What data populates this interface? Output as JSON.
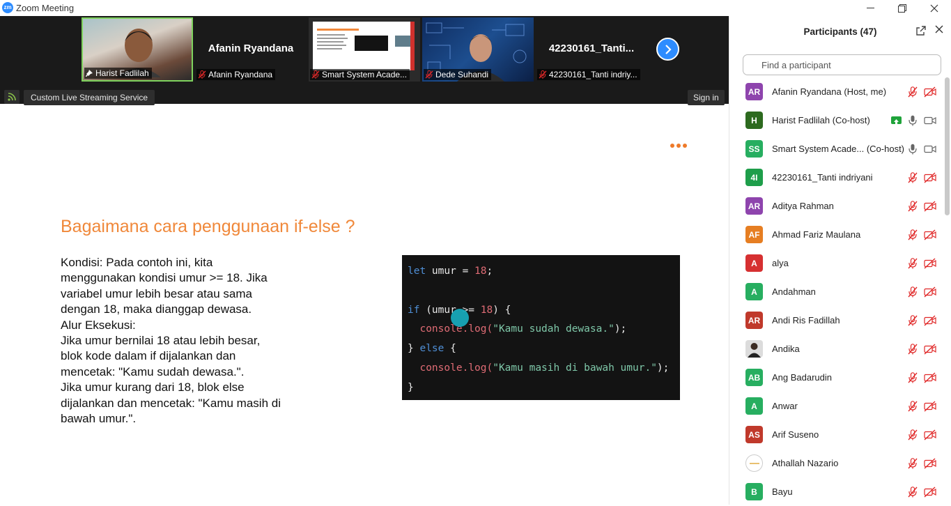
{
  "window": {
    "title": "Zoom Meeting",
    "logo_text": "zm"
  },
  "video_strip": {
    "tiles": [
      {
        "name": "Harist Fadlilah",
        "type": "video"
      },
      {
        "name": "Afanin Ryandana",
        "big_name": "Afanin Ryandana",
        "type": "name"
      },
      {
        "name": "Smart System Acade...",
        "type": "screen"
      },
      {
        "name": "Dede Suhandi",
        "type": "video"
      },
      {
        "name": "42230161_Tanti indriy...",
        "big_name": "42230161_Tanti...",
        "type": "name"
      }
    ],
    "stream_label": "Custom Live Streaming Service",
    "signin_label": "Sign in"
  },
  "slide": {
    "title": "Bagaimana cara penggunaan if-else ?",
    "body": "Kondisi: Pada contoh ini, kita\nmenggunakan kondisi umur >= 18. Jika\nvariabel umur lebih besar atau sama\ndengan 18, maka dianggap dewasa.\nAlur Eksekusi:\nJika umur bernilai 18 atau lebih besar,\nblok kode dalam if dijalankan dan\nmencetak: \"Kamu sudah dewasa.\".\nJika umur kurang dari 18, blok else\ndijalankan dan mencetak: \"Kamu masih di\nbawah umur.\".",
    "code": {
      "l1_kw": "let",
      "l1_rest": " umur = ",
      "l1_num": "18",
      "l1_end": ";",
      "l3_kw": "if",
      "l3_a": " (umur >= ",
      "l3_num": "18",
      "l3_b": ") {",
      "l4_fn": "  console.log(",
      "l4_str": "\"Kamu sudah dewasa.\"",
      "l4_end": ");",
      "l5_a": "} ",
      "l5_kw": "else",
      "l5_b": " {",
      "l6_fn": "  console.log(",
      "l6_str": "\"Kamu masih di bawah umur.\"",
      "l6_end": ");",
      "l7": "}"
    }
  },
  "participants_panel": {
    "title": "Participants (47)",
    "search_placeholder": "Find a participant",
    "participants": [
      {
        "initials": "AR",
        "name": "Afanin Ryandana (Host, me)",
        "color": "#8e44ad",
        "mic": "muted",
        "cam": "off"
      },
      {
        "initials": "H",
        "name": "Harist Fadlilah (Co-host)",
        "color": "#2d6a1f",
        "mic": "on",
        "cam": "on",
        "sharing": true
      },
      {
        "initials": "SS",
        "name": "Smart System Acade...   (Co-host)",
        "color": "#27ae60",
        "mic": "on",
        "cam": "on"
      },
      {
        "initials": "4I",
        "name": "42230161_Tanti indriyani",
        "color": "#1e9e4a",
        "mic": "muted",
        "cam": "off"
      },
      {
        "initials": "AR",
        "name": "Aditya Rahman",
        "color": "#8e44ad",
        "mic": "muted",
        "cam": "off"
      },
      {
        "initials": "AF",
        "name": "Ahmad Fariz Maulana",
        "color": "#e67e22",
        "mic": "muted",
        "cam": "off"
      },
      {
        "initials": "A",
        "name": "alya",
        "color": "#d63031",
        "mic": "muted",
        "cam": "off"
      },
      {
        "initials": "A",
        "name": "Andahman",
        "color": "#27ae60",
        "mic": "muted",
        "cam": "off"
      },
      {
        "initials": "AR",
        "name": "Andi Ris Fadillah",
        "color": "#c0392b",
        "mic": "muted",
        "cam": "off"
      },
      {
        "initials": "",
        "name": "Andika",
        "color": "#555555",
        "mic": "muted",
        "cam": "off",
        "photo": true
      },
      {
        "initials": "AB",
        "name": "Ang Badarudin",
        "color": "#27ae60",
        "mic": "muted",
        "cam": "off"
      },
      {
        "initials": "A",
        "name": "Anwar",
        "color": "#27ae60",
        "mic": "muted",
        "cam": "off"
      },
      {
        "initials": "AS",
        "name": "Arif Suseno",
        "color": "#c0392b",
        "mic": "muted",
        "cam": "off"
      },
      {
        "initials": "",
        "name": "Athallah Nazario",
        "color": "#ffffff",
        "mic": "muted",
        "cam": "off",
        "logo": true
      },
      {
        "initials": "B",
        "name": "Bayu",
        "color": "#27ae60",
        "mic": "muted",
        "cam": "off"
      }
    ]
  },
  "icons": {
    "mic_muted": "mic-muted-icon",
    "cam_off": "camera-off-icon",
    "search": "search-icon"
  }
}
